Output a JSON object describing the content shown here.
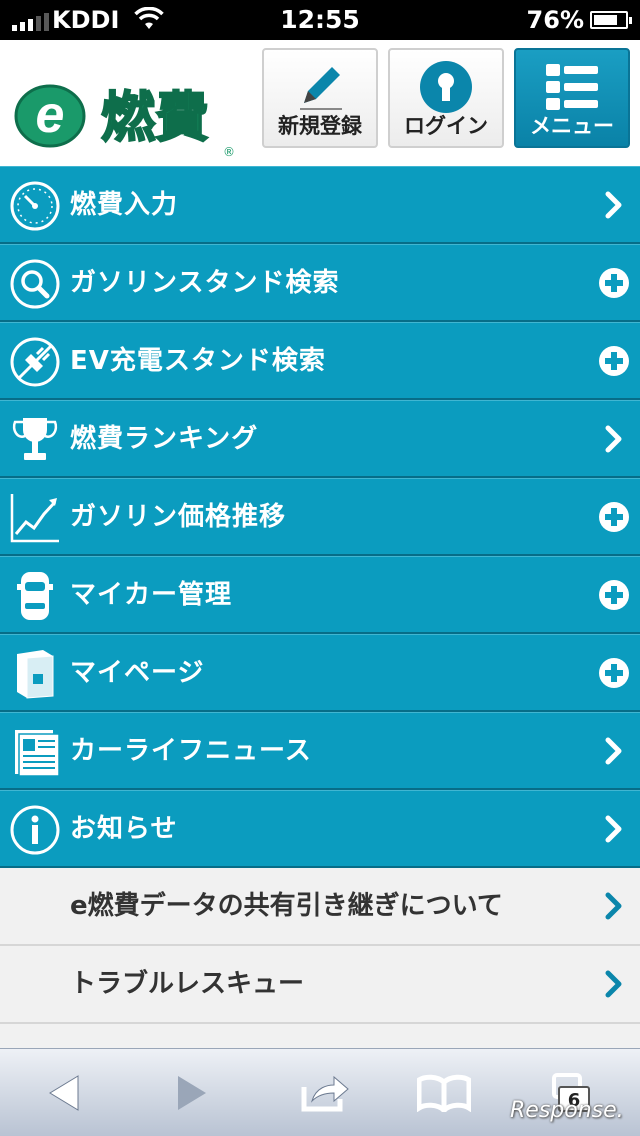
{
  "status_bar": {
    "carrier": "KDDI",
    "time": "12:55",
    "battery": "76%",
    "battery_level": 0.76
  },
  "header": {
    "logo_text": "e燃費",
    "buttons": [
      {
        "label": "新規登録",
        "icon": "pencil-icon"
      },
      {
        "label": "ログイン",
        "icon": "keyhole-icon"
      },
      {
        "label": "メニュー",
        "icon": "list-icon"
      }
    ]
  },
  "menu": {
    "items": [
      {
        "label": "燃費入力",
        "icon": "speedometer-icon",
        "trailing": "chevron"
      },
      {
        "label": "ガソリンスタンド検索",
        "icon": "search-icon",
        "trailing": "plus"
      },
      {
        "label": "EV充電スタンド検索",
        "icon": "plug-icon",
        "trailing": "plus"
      },
      {
        "label": "燃費ランキング",
        "icon": "trophy-icon",
        "trailing": "chevron"
      },
      {
        "label": "ガソリン価格推移",
        "icon": "line-chart-icon",
        "trailing": "plus"
      },
      {
        "label": "マイカー管理",
        "icon": "car-icon",
        "trailing": "plus"
      },
      {
        "label": "マイページ",
        "icon": "book-icon",
        "trailing": "plus"
      },
      {
        "label": "カーライフニュース",
        "icon": "newspaper-icon",
        "trailing": "chevron"
      },
      {
        "label": "お知らせ",
        "icon": "info-icon",
        "trailing": "chevron"
      }
    ],
    "sub_items": [
      {
        "label": "e燃費データの共有引き継ぎについて"
      },
      {
        "label": "トラブルレスキュー"
      }
    ]
  },
  "toolbar": {
    "tab_count": "6",
    "watermark": "Response."
  },
  "colors": {
    "accent": "#0b9cbf",
    "accent_dark": "#076d88",
    "logo_green": "#1a9a6a",
    "sub_bg": "#f1f1f1"
  }
}
